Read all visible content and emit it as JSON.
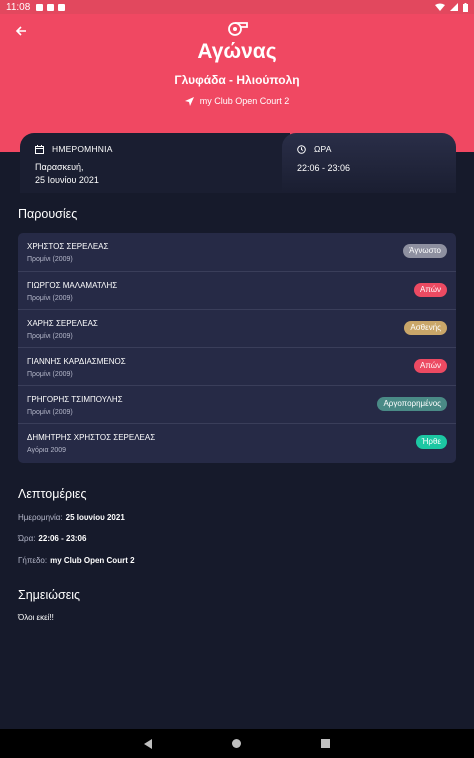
{
  "status_bar": {
    "time": "11:08"
  },
  "header": {
    "title": "Αγώνας",
    "subtitle": "Γλυφάδα - Ηλιούπολη",
    "venue": "my Club Open Court 2"
  },
  "date_card": {
    "label": "ΗΜΕΡΟΜΗΝΙΑ",
    "value_line1": "Παρασκευή,",
    "value_line2": "25 Ιουνίου 2021"
  },
  "time_card": {
    "label": "ΩΡΑ",
    "value": "22:06 - 23:06"
  },
  "attendance": {
    "title": "Παρουσίες",
    "rows": [
      {
        "name": "ΧΡΗΣΤΟΣ ΣΕΡΕΛΕΑΣ",
        "category": "Προμίνι (2009)",
        "status": "Άγνωστο",
        "color": "#8e90a0"
      },
      {
        "name": "ΓΙΩΡΓΟΣ ΜΑΛΑΜΑΤΛΗΣ",
        "category": "Προμίνι (2009)",
        "status": "Απών",
        "color": "#ec4a62"
      },
      {
        "name": "ΧΑΡΗΣ ΣΕΡΕΛΕΑΣ",
        "category": "Προμίνι (2009)",
        "status": "Ασθενής",
        "color": "#c9a669"
      },
      {
        "name": "ΓΙΑΝΝΗΣ ΚΑΡΔΙΑΣΜΕΝΟΣ",
        "category": "Προμίνι (2009)",
        "status": "Απών",
        "color": "#ec4a62"
      },
      {
        "name": "ΓΡΗΓΟΡΗΣ ΤΣΙΜΠΟΥΛΗΣ",
        "category": "Προμίνι (2009)",
        "status": "Αργοπορημένος",
        "color": "#4a8a86"
      },
      {
        "name": "ΔΗΜΗΤΡΗΣ ΧΡΗΣΤΟΣ ΣΕΡΕΛΕΑΣ",
        "category": "Αγόρια 2009",
        "status": "Ήρθε",
        "color": "#1cc7a3"
      }
    ]
  },
  "details": {
    "title": "Λεπτομέριες",
    "date_label": "Ημερομηνία:",
    "date_value": "25 Ιουνίου 2021",
    "time_label": "Ώρα:",
    "time_value": "22:06 - 23:06",
    "court_label": "Γήπεδο:",
    "court_value": "my Club Open Court 2"
  },
  "notes": {
    "title": "Σημειώσεις",
    "text": "Όλοι εκεί!!"
  },
  "colors": {
    "accent": "#f04862",
    "background": "#161a2b",
    "card": "#262a46"
  },
  "icons": [
    "back-arrow-icon",
    "whistle-icon",
    "location-arrow-icon",
    "calendar-icon",
    "clock-icon"
  ]
}
